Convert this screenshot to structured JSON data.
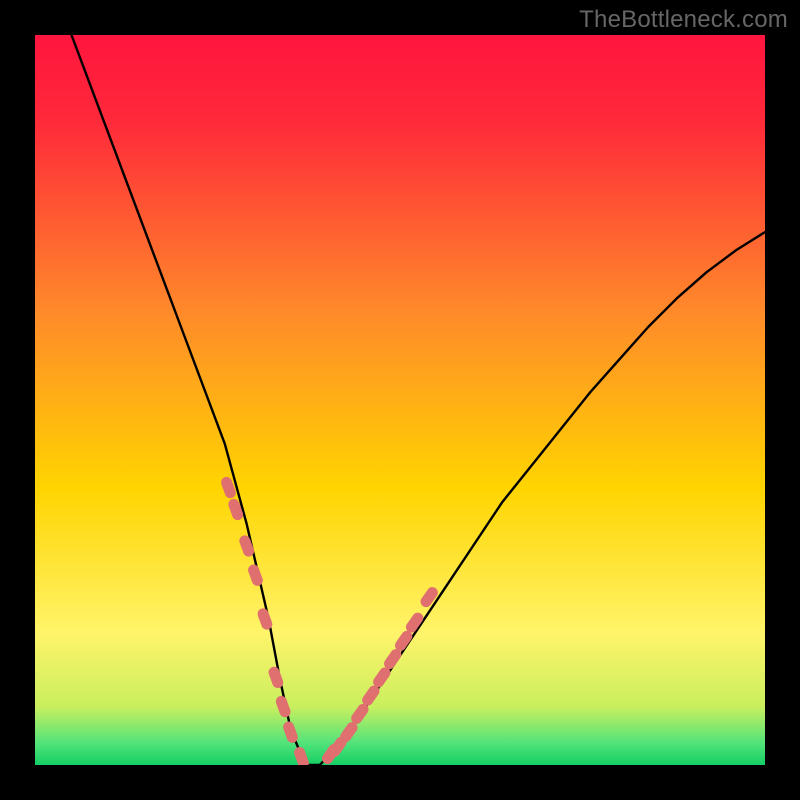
{
  "watermark": "TheBottleneck.com",
  "colors": {
    "top": "#ff153e",
    "mid": "#ffd400",
    "low": "#fff46a",
    "green": "#19e36b",
    "curve": "#000000",
    "marker": "#e07070",
    "bg": "#000000"
  },
  "chart_data": {
    "type": "line",
    "title": "",
    "xlabel": "",
    "ylabel": "",
    "xlim": [
      0,
      100
    ],
    "ylim": [
      0,
      100
    ],
    "series": [
      {
        "name": "bottleneck-curve",
        "x": [
          5,
          8,
          11,
          14,
          17,
          20,
          23,
          26,
          29,
          32,
          33.5,
          35,
          37,
          39,
          41,
          44,
          48,
          52,
          56,
          60,
          64,
          68,
          72,
          76,
          80,
          84,
          88,
          92,
          96,
          100
        ],
        "y": [
          100,
          92,
          84,
          76,
          68,
          60,
          52,
          44,
          33,
          20,
          12,
          5,
          0,
          0,
          2,
          6,
          12,
          18,
          24,
          30,
          36,
          41,
          46,
          51,
          55.5,
          60,
          64,
          67.5,
          70.5,
          73
        ]
      }
    ],
    "markers": [
      {
        "name": "left-markers",
        "points": [
          {
            "x": 26.5,
            "y": 38
          },
          {
            "x": 27.5,
            "y": 35
          },
          {
            "x": 29.0,
            "y": 30
          },
          {
            "x": 30.2,
            "y": 26
          },
          {
            "x": 31.5,
            "y": 20
          },
          {
            "x": 33.0,
            "y": 12
          },
          {
            "x": 34.0,
            "y": 8
          },
          {
            "x": 35.0,
            "y": 4.5
          },
          {
            "x": 36.5,
            "y": 1
          }
        ]
      },
      {
        "name": "right-markers",
        "points": [
          {
            "x": 40.5,
            "y": 1.5
          },
          {
            "x": 41.5,
            "y": 2.5
          },
          {
            "x": 43.0,
            "y": 4.5
          },
          {
            "x": 44.5,
            "y": 7
          },
          {
            "x": 46.0,
            "y": 9.5
          },
          {
            "x": 47.5,
            "y": 12
          },
          {
            "x": 49.0,
            "y": 14.5
          },
          {
            "x": 50.5,
            "y": 17
          },
          {
            "x": 52.0,
            "y": 19.5
          },
          {
            "x": 54.0,
            "y": 23
          }
        ]
      }
    ],
    "gradient_stops": [
      {
        "offset": 0.0,
        "color": "#ff153e"
      },
      {
        "offset": 0.12,
        "color": "#ff2a3a"
      },
      {
        "offset": 0.38,
        "color": "#ff8a2a"
      },
      {
        "offset": 0.62,
        "color": "#ffd400"
      },
      {
        "offset": 0.82,
        "color": "#fff46a"
      },
      {
        "offset": 0.92,
        "color": "#c9ef5e"
      },
      {
        "offset": 0.97,
        "color": "#52e37a"
      },
      {
        "offset": 1.0,
        "color": "#14cf64"
      }
    ]
  }
}
